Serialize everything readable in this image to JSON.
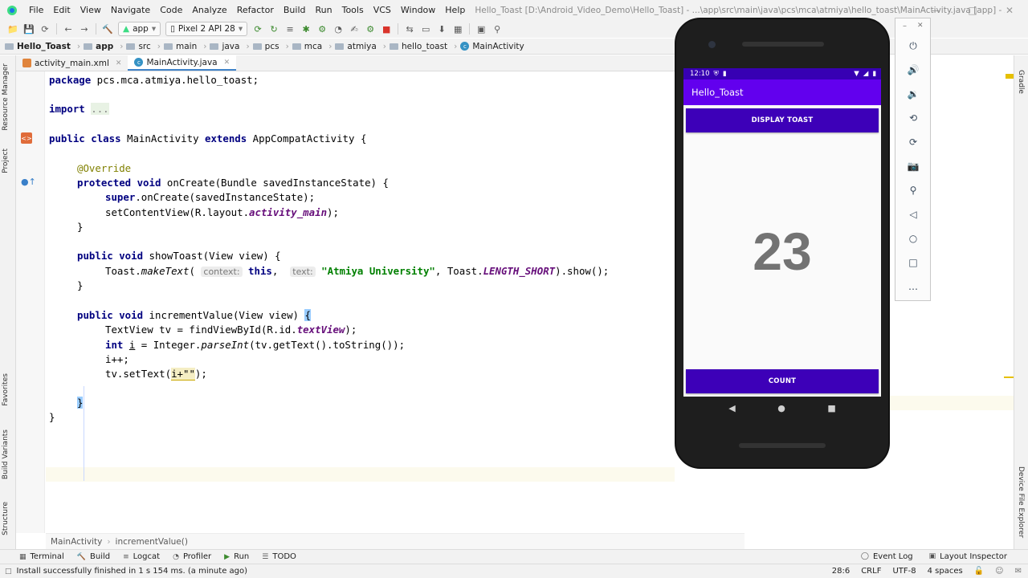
{
  "window": {
    "title": "Hello_Toast [D:\\Android_Video_Demo\\Hello_Toast] - ...\\app\\src\\main\\java\\pcs\\mca\\atmiya\\hello_toast\\MainActivity.java [app] - Android Studio",
    "menus": [
      "File",
      "Edit",
      "View",
      "Navigate",
      "Code",
      "Analyze",
      "Refactor",
      "Build",
      "Run",
      "Tools",
      "VCS",
      "Window",
      "Help"
    ]
  },
  "toolbar": {
    "module": "app",
    "device": "Pixel 2 API 28"
  },
  "breadcrumb": [
    "Hello_Toast",
    "app",
    "src",
    "main",
    "java",
    "pcs",
    "mca",
    "atmiya",
    "hello_toast",
    "MainActivity"
  ],
  "tabs": [
    {
      "label": "activity_main.xml",
      "active": false
    },
    {
      "label": "MainActivity.java",
      "active": true
    }
  ],
  "left_tools": [
    "Resource Manager",
    "Project",
    "Favorites",
    "Build Variants",
    "Structure"
  ],
  "right_tools": [
    "Gradle",
    "Device File Explorer"
  ],
  "code": {
    "package_kw": "package",
    "package_name": " pcs.mca.atmiya.hello_toast;",
    "import_kw": "import",
    "import_fold": "...",
    "class_public": "public",
    "class_kw": "class",
    "class_name": " MainActivity ",
    "extends_kw": "extends",
    "class_parent": " AppCompatActivity {",
    "override": "@Override",
    "oncreate_mods": "protected void",
    "oncreate_sig": " onCreate(Bundle savedInstanceState) {",
    "super_kw": "super",
    "super_call": ".onCreate(savedInstanceState);",
    "setcontent_a": "setContentView(R.layout.",
    "setcontent_field": "activity_main",
    "setcontent_b": ");",
    "close_brace": "}",
    "showtoast_mods": "public void",
    "showtoast_sig": " showToast(View view) {",
    "toast_a": "Toast.",
    "toast_method": "makeText",
    "toast_paren": "(",
    "hint_context": "context:",
    "this_kw": "this",
    "toast_comma": ", ",
    "hint_text": "text:",
    "toast_string": "\"Atmiya University\"",
    "toast_c": ", Toast.",
    "toast_field": "LENGTH_SHORT",
    "toast_d": ").show();",
    "inc_mods": "public void",
    "inc_sig": " incrementValue(View view) ",
    "inc_brace": "{",
    "tv_a": "TextView tv = findViewById(R.id.",
    "tv_field": "textView",
    "tv_b": ");",
    "int_kw": "int",
    "int_var": "i",
    "int_a": " = Integer.",
    "int_method": "parseInt",
    "int_b": "(tv.getText().toString());",
    "incr": "i++;",
    "settext_a": "tv.setText(",
    "settext_warn": "i+\"\"",
    "settext_b": ");"
  },
  "editor_crumb": [
    "MainActivity",
    "incrementValue()"
  ],
  "bottom_tools": [
    {
      "icon": "terminal-icon",
      "label": "Terminal"
    },
    {
      "icon": "hammer-icon",
      "label": "Build"
    },
    {
      "icon": "logcat-icon",
      "label": "Logcat"
    },
    {
      "icon": "profiler-icon",
      "label": "Profiler"
    },
    {
      "icon": "run-icon",
      "label": "Run"
    },
    {
      "icon": "todo-icon",
      "label": "TODO"
    }
  ],
  "bottom_right": {
    "event_log": "Event Log",
    "layout_inspector": "Layout Inspector"
  },
  "status": {
    "message": "Install successfully finished in 1 s 154 ms. (a minute ago)",
    "position": "28:6",
    "line_sep": "CRLF",
    "encoding": "UTF-8",
    "indent": "4 spaces"
  },
  "emulator": {
    "clock": "12:10",
    "app_title": "Hello_Toast",
    "toast_button": "DISPLAY TOAST",
    "count_value": "23",
    "count_button": "COUNT"
  },
  "colors": {
    "app_bar": "#6200ee",
    "status_bar": "#3700b3",
    "button": "#3d00b8",
    "count_text": "#737373"
  }
}
